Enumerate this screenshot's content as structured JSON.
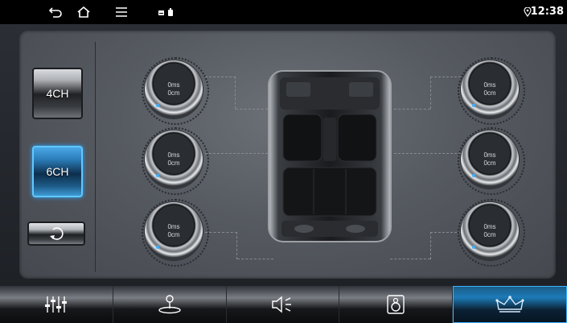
{
  "status_bar": {
    "time": "12:38"
  },
  "left_panel": {
    "modes": [
      {
        "label": "4CH",
        "active": false
      },
      {
        "label": "6CH",
        "active": true
      }
    ]
  },
  "knobs": {
    "front_left": {
      "delay": "0ms",
      "distance": "0cm"
    },
    "middle_left": {
      "delay": "0ms",
      "distance": "0cm"
    },
    "rear_left": {
      "delay": "0ms",
      "distance": "0cm"
    },
    "front_right": {
      "delay": "0ms",
      "distance": "0cm"
    },
    "middle_right": {
      "delay": "0ms",
      "distance": "0cm"
    },
    "rear_right": {
      "delay": "0ms",
      "distance": "0cm"
    }
  },
  "bottom_tabs": [
    {
      "icon": "equalizer-sliders-icon",
      "active": false
    },
    {
      "icon": "joystick-balance-icon",
      "active": false
    },
    {
      "icon": "speaker-sound-icon",
      "active": false
    },
    {
      "icon": "subwoofer-speaker-icon",
      "active": false
    },
    {
      "icon": "crown-icon",
      "active": true
    }
  ],
  "colors": {
    "accent": "#2aa3ff",
    "panel": "#5a5e65",
    "statusbar": "#000000"
  }
}
